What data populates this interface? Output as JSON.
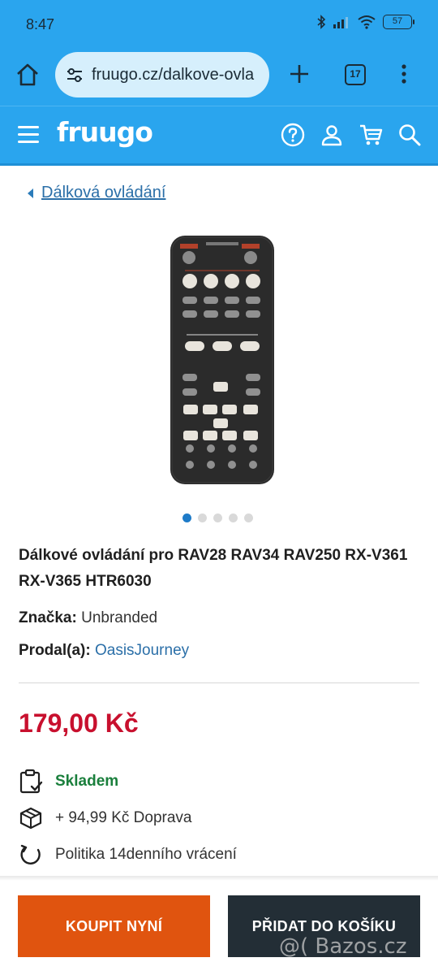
{
  "status_bar": {
    "time": "8:47",
    "battery": "57"
  },
  "browser": {
    "url": "fruugo.cz/dalkove-ovla",
    "tab_count": "17"
  },
  "site": {
    "logo": "fruugo"
  },
  "breadcrumb": {
    "label": "Dálková ovládání"
  },
  "product": {
    "title": "Dálkové ovládání pro RAV28 RAV34 RAV250 RX-V361 RX-V365 HTR6030",
    "brand_label": "Značka:",
    "brand_value": "Unbranded",
    "seller_label": "Prodal(a):",
    "seller_value": "OasisJourney",
    "price": "179,00 Kč",
    "image_count": 5,
    "active_image": 1
  },
  "info": {
    "stock": "Skladem",
    "shipping": "+ 94,99 Kč Doprava",
    "returns": "Politika 14denního vrácení"
  },
  "actions": {
    "buy_now": "KOUPIT NYNÍ",
    "add_to_cart": "PŘIDAT DO KOŠÍKU"
  },
  "watermark": "@( Bazos.cz",
  "colors": {
    "brand_blue": "#2aa5ee",
    "price_red": "#c8102e",
    "stock_green": "#1a7f3c",
    "buy_orange": "#e0540f",
    "cart_dark": "#232e36"
  }
}
